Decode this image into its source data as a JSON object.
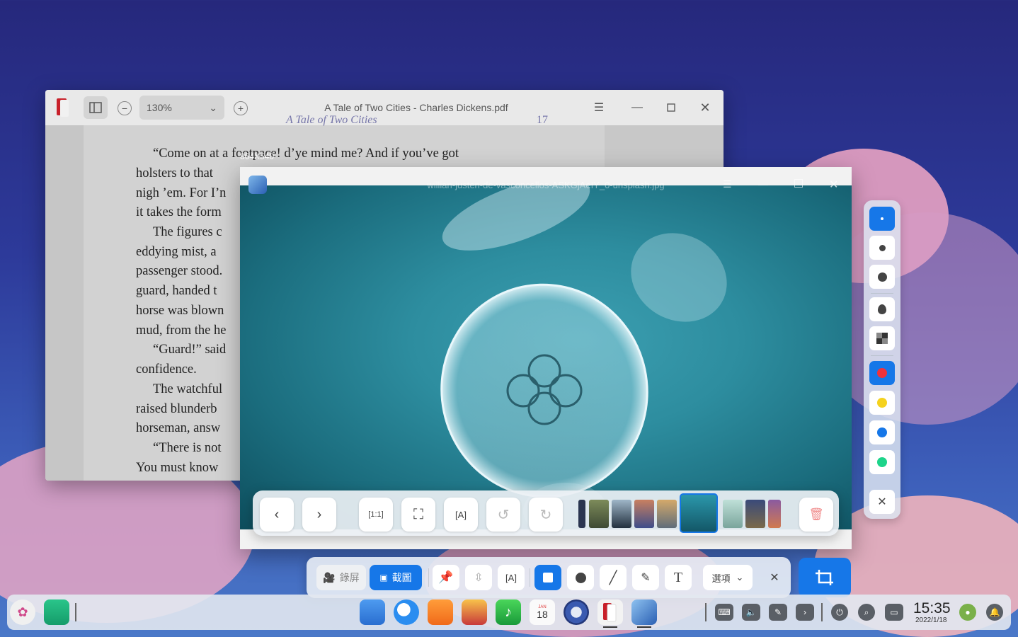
{
  "pdf_window": {
    "zoom": "130%",
    "title": "A Tale of Two Cities - Charles Dickens.pdf",
    "header_partial": "A Tale of Two Cities",
    "page_number_partial": "17",
    "lines": [
      "“Come on at a footpace! d’ye mind me? And if you’ve got",
      "holsters to that",
      "nigh ’em. For I’n",
      "it takes the form",
      "The figures c",
      "eddying mist, a",
      "passenger stood.",
      "guard, handed t",
      "horse was blown",
      "mud, from the he",
      "“Guard!” said",
      "confidence.",
      "The watchful",
      "raised blunderb",
      "horseman, answ",
      "“There is not",
      "You must know"
    ]
  },
  "selection_size": "864X540",
  "viewer": {
    "title": "willian-justen-de-vasconcellos-ASKGjAeIY_0-unsplash.jpg"
  },
  "screenshot_toolbar": {
    "record_label": "錄屏",
    "capture_label": "截圖",
    "options_label": "選項"
  },
  "taskbar": {
    "time": "15:35",
    "date": "2022/1/18",
    "calendar_day": "18",
    "calendar_month": "JAN"
  },
  "colors": {
    "accent": "#1677e8",
    "red": "#f0323c",
    "yellow": "#f5d21e",
    "blue": "#1677e8",
    "green": "#1dd48a"
  }
}
